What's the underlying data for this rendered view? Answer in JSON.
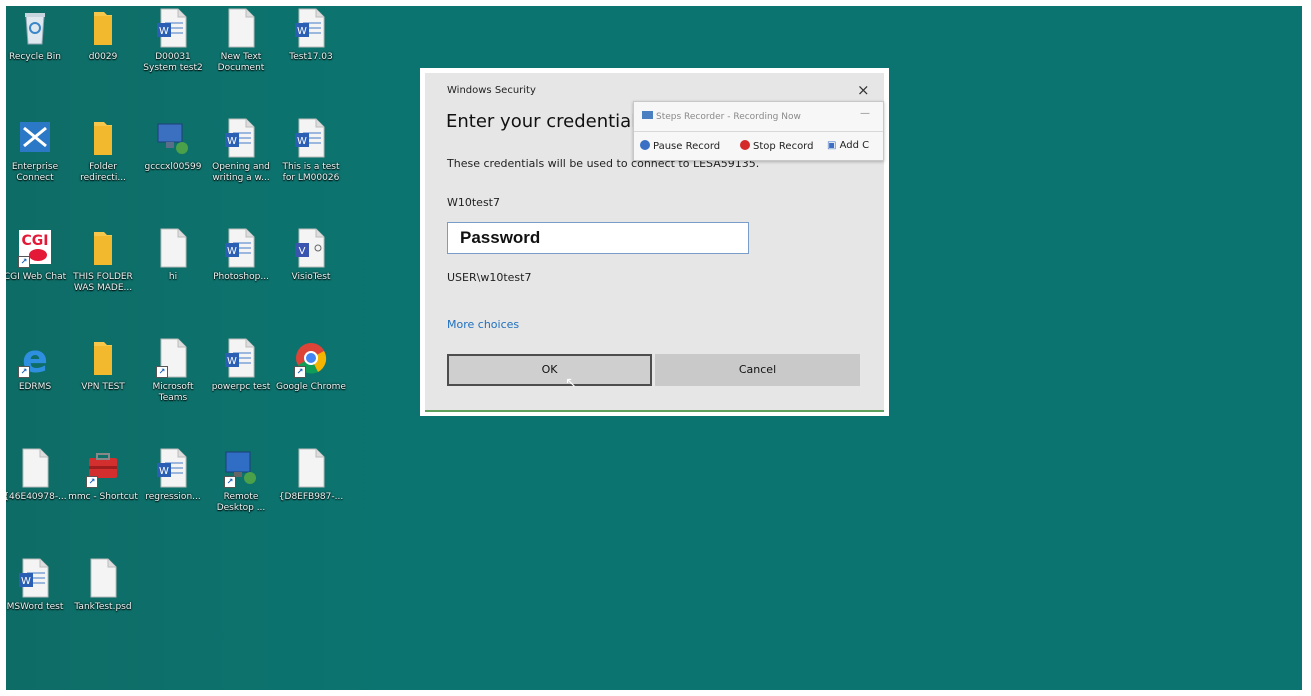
{
  "desktop": {
    "icons": [
      {
        "label": "Recycle Bin",
        "icon": "recycle-bin-icon"
      },
      {
        "label": "d0029",
        "icon": "folder-icon"
      },
      {
        "label": "D00031 System test2",
        "icon": "word-document-icon"
      },
      {
        "label": "New Text Document",
        "icon": "text-document-icon"
      },
      {
        "label": "Test17.03",
        "icon": "word-document-icon"
      },
      {
        "label": "Enterprise Connect",
        "icon": "enterprise-connect-icon"
      },
      {
        "label": "Folder redirecti...",
        "icon": "folder-icon"
      },
      {
        "label": "gcccxl00599",
        "icon": "network-computer-icon"
      },
      {
        "label": "Opening and writing a w...",
        "icon": "word-document-icon"
      },
      {
        "label": "This is a test for LM00026",
        "icon": "word-document-icon"
      },
      {
        "label": "CGI Web Chat",
        "icon": "cgi-chat-icon"
      },
      {
        "label": "THIS FOLDER WAS MADE...",
        "icon": "folder-icon"
      },
      {
        "label": "hi",
        "icon": "text-document-icon"
      },
      {
        "label": "Photoshop...",
        "icon": "word-document-icon"
      },
      {
        "label": "VisioTest",
        "icon": "visio-document-icon"
      },
      {
        "label": "EDRMS",
        "icon": "internet-explorer-icon"
      },
      {
        "label": "VPN TEST",
        "icon": "folder-icon"
      },
      {
        "label": "Microsoft Teams",
        "icon": "text-document-icon"
      },
      {
        "label": "powerpc test",
        "icon": "word-document-icon"
      },
      {
        "label": "Google Chrome",
        "icon": "chrome-icon"
      },
      {
        "label": "{46E40978-...",
        "icon": "text-document-icon"
      },
      {
        "label": "mmc - Shortcut",
        "icon": "toolbox-icon"
      },
      {
        "label": "regression...",
        "icon": "word-document-icon"
      },
      {
        "label": "Remote Desktop ...",
        "icon": "remote-desktop-icon"
      },
      {
        "label": "{D8EFB987-...",
        "icon": "text-document-icon"
      },
      {
        "label": "MSWord test",
        "icon": "word-document-icon"
      },
      {
        "label": "TankTest.psd",
        "icon": "text-document-icon"
      }
    ]
  },
  "dialog": {
    "title": "Windows Security",
    "close": "×",
    "heading": "Enter your credentials",
    "description": "These credentials will be used to connect to LESA59135.",
    "username": "W10test7",
    "password_placeholder": "Password",
    "domain_user": "USER\\w10test7",
    "more_choices": "More choices",
    "ok": "OK",
    "cancel": "Cancel"
  },
  "recorder": {
    "title": "Steps Recorder - Recording Now",
    "minimize": "—",
    "pause": "Pause Record",
    "stop": "Stop Record",
    "add": "Add C"
  }
}
